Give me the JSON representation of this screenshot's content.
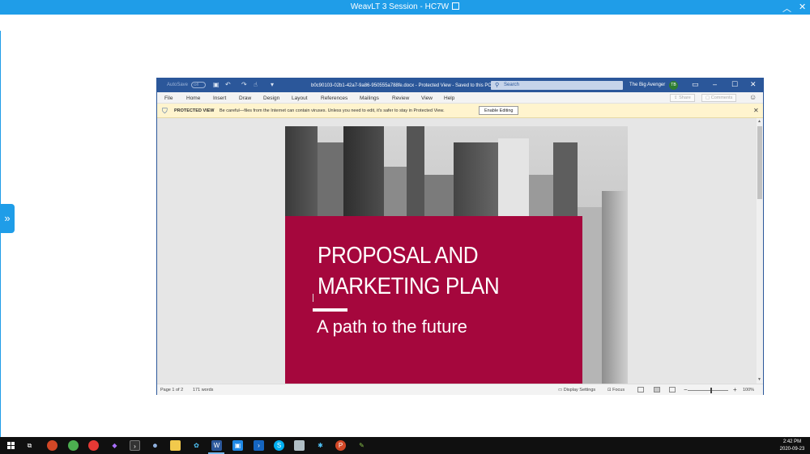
{
  "session": {
    "title": "WeavLT 3  Session - HC7W",
    "collapse_icon": "chevron-up",
    "close_icon": "close"
  },
  "word": {
    "autosave_label": "AutoSave",
    "autosave_state": "Off",
    "doc_title": "b0c90103-02b1-42a7-9a86-950555a788fe.docx  -  Protected View  -  Saved to this PC ▾",
    "search_placeholder": "Search",
    "user_name": "The Big Avenger",
    "user_initials": "TB",
    "menu": [
      "File",
      "Home",
      "Insert",
      "Draw",
      "Design",
      "Layout",
      "References",
      "Mailings",
      "Review",
      "View",
      "Help"
    ],
    "share_label": "Share",
    "comments_label": "Comments",
    "protected_label": "PROTECTED VIEW",
    "protected_msg": "Be careful—files from the Internet can contain viruses. Unless you need to edit, it's safer to stay in Protected View.",
    "enable_label": "Enable Editing",
    "page_title": "PROPOSAL AND MARKETING PLAN",
    "page_title_line1": "PROPOSAL AND",
    "page_title_line2": "MARKETING PLAN",
    "page_subtitle": "A path to the future",
    "status": {
      "page": "Page 1 of 2",
      "words": "171 words",
      "display_settings": "Display Settings",
      "focus": "Focus",
      "zoom": "100%",
      "zoom_minus": "−",
      "zoom_plus": "+"
    },
    "accent": "#2b579a",
    "cover_color": "#a5073d"
  },
  "taskbar": {
    "time": "2:42 PM",
    "date": "2020-09-23",
    "apps": [
      "task-view",
      "chrome-canary",
      "chrome",
      "chrome-dev",
      "visual-studio",
      "terminal",
      "people",
      "file-explorer",
      "windows-store",
      "word",
      "remote-desktop",
      "powershell",
      "skype",
      "network-tool",
      "settings-tool",
      "powerpoint",
      "paint"
    ]
  }
}
